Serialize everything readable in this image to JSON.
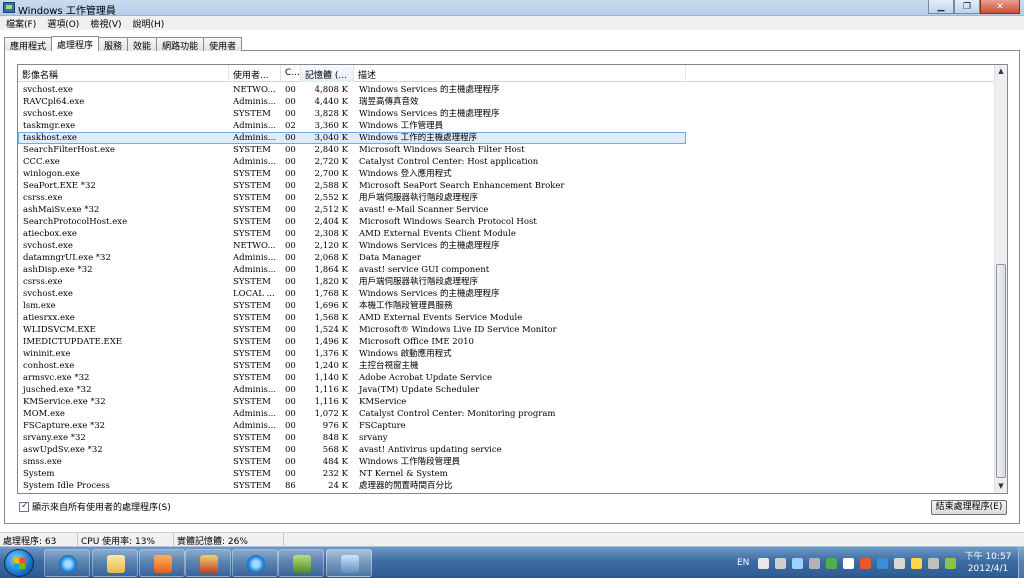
{
  "window": {
    "title": "Windows 工作管理員",
    "min_label": "▁",
    "max_label": "❐",
    "close_label": "✕"
  },
  "menu": [
    "檔案(F)",
    "選項(O)",
    "檢視(V)",
    "說明(H)"
  ],
  "tabs": [
    {
      "label": "應用程式",
      "active": false
    },
    {
      "label": "處理程序",
      "active": true
    },
    {
      "label": "服務",
      "active": false
    },
    {
      "label": "效能",
      "active": false
    },
    {
      "label": "網路功能",
      "active": false
    },
    {
      "label": "使用者",
      "active": false
    }
  ],
  "columns": {
    "name": "影像名稱",
    "user": "使用者...",
    "cpu": "C...",
    "memory": "記憶體 (...",
    "description": "描述"
  },
  "processes": [
    {
      "name": "svchost.exe",
      "user": "NETWO...",
      "cpu": "00",
      "mem": "4,808 K",
      "desc": "Windows Services 的主機處理程序"
    },
    {
      "name": "RAVCpl64.exe",
      "user": "Adminis...",
      "cpu": "00",
      "mem": "4,440 K",
      "desc": "瑞昱高傳真音效"
    },
    {
      "name": "svchost.exe",
      "user": "SYSTEM",
      "cpu": "00",
      "mem": "3,828 K",
      "desc": "Windows Services 的主機處理程序"
    },
    {
      "name": "taskmgr.exe",
      "user": "Adminis...",
      "cpu": "02",
      "mem": "3,360 K",
      "desc": "Windows 工作管理員"
    },
    {
      "name": "taskhost.exe",
      "user": "Adminis...",
      "cpu": "00",
      "mem": "3,040 K",
      "desc": "Windows 工作的主機處理程序"
    },
    {
      "name": "SearchFilterHost.exe",
      "user": "SYSTEM",
      "cpu": "00",
      "mem": "2,840 K",
      "desc": "Microsoft Windows Search Filter Host"
    },
    {
      "name": "CCC.exe",
      "user": "Adminis...",
      "cpu": "00",
      "mem": "2,720 K",
      "desc": "Catalyst Control Center: Host application"
    },
    {
      "name": "winlogon.exe",
      "user": "SYSTEM",
      "cpu": "00",
      "mem": "2,700 K",
      "desc": "Windows 登入應用程式"
    },
    {
      "name": "SeaPort.EXE *32",
      "user": "SYSTEM",
      "cpu": "00",
      "mem": "2,588 K",
      "desc": "Microsoft SeaPort Search Enhancement Broker"
    },
    {
      "name": "csrss.exe",
      "user": "SYSTEM",
      "cpu": "00",
      "mem": "2,552 K",
      "desc": "用戶端伺服器執行階段處理程序"
    },
    {
      "name": "ashMaiSv.exe *32",
      "user": "SYSTEM",
      "cpu": "00",
      "mem": "2,512 K",
      "desc": "avast! e-Mail Scanner Service"
    },
    {
      "name": "SearchProtocolHost.exe",
      "user": "SYSTEM",
      "cpu": "00",
      "mem": "2,404 K",
      "desc": "Microsoft Windows Search Protocol Host"
    },
    {
      "name": "atiecbox.exe",
      "user": "SYSTEM",
      "cpu": "00",
      "mem": "2,308 K",
      "desc": "AMD External Events Client Module"
    },
    {
      "name": "svchost.exe",
      "user": "NETWO...",
      "cpu": "00",
      "mem": "2,120 K",
      "desc": "Windows Services 的主機處理程序"
    },
    {
      "name": "datamngrUI.exe *32",
      "user": "Adminis...",
      "cpu": "00",
      "mem": "2,068 K",
      "desc": "Data Manager"
    },
    {
      "name": "ashDisp.exe *32",
      "user": "Adminis...",
      "cpu": "00",
      "mem": "1,864 K",
      "desc": "avast! service GUI component"
    },
    {
      "name": "csrss.exe",
      "user": "SYSTEM",
      "cpu": "00",
      "mem": "1,820 K",
      "desc": "用戶端伺服器執行階段處理程序"
    },
    {
      "name": "svchost.exe",
      "user": "LOCAL ...",
      "cpu": "00",
      "mem": "1,768 K",
      "desc": "Windows Services 的主機處理程序"
    },
    {
      "name": "lsm.exe",
      "user": "SYSTEM",
      "cpu": "00",
      "mem": "1,696 K",
      "desc": "本機工作階段管理員服務"
    },
    {
      "name": "atiesrxx.exe",
      "user": "SYSTEM",
      "cpu": "00",
      "mem": "1,568 K",
      "desc": "AMD External Events Service Module"
    },
    {
      "name": "WLIDSVCM.EXE",
      "user": "SYSTEM",
      "cpu": "00",
      "mem": "1,524 K",
      "desc": "Microsoft® Windows Live ID Service Monitor"
    },
    {
      "name": "IMEDICTUPDATE.EXE",
      "user": "SYSTEM",
      "cpu": "00",
      "mem": "1,496 K",
      "desc": "Microsoft Office IME 2010"
    },
    {
      "name": "wininit.exe",
      "user": "SYSTEM",
      "cpu": "00",
      "mem": "1,376 K",
      "desc": "Windows 啟動應用程式"
    },
    {
      "name": "conhost.exe",
      "user": "SYSTEM",
      "cpu": "00",
      "mem": "1,240 K",
      "desc": "主控台視窗主機"
    },
    {
      "name": "armsvc.exe *32",
      "user": "SYSTEM",
      "cpu": "00",
      "mem": "1,140 K",
      "desc": "Adobe Acrobat Update Service"
    },
    {
      "name": "jusched.exe *32",
      "user": "Adminis...",
      "cpu": "00",
      "mem": "1,116 K",
      "desc": "Java(TM) Update Scheduler"
    },
    {
      "name": "KMService.exe *32",
      "user": "SYSTEM",
      "cpu": "00",
      "mem": "1,116 K",
      "desc": "KMService"
    },
    {
      "name": "MOM.exe",
      "user": "Adminis...",
      "cpu": "00",
      "mem": "1,072 K",
      "desc": "Catalyst Control Center: Monitoring program"
    },
    {
      "name": "FSCapture.exe *32",
      "user": "Adminis...",
      "cpu": "00",
      "mem": "976 K",
      "desc": "FSCapture"
    },
    {
      "name": "srvany.exe *32",
      "user": "SYSTEM",
      "cpu": "00",
      "mem": "848 K",
      "desc": "srvany"
    },
    {
      "name": "aswUpdSv.exe *32",
      "user": "SYSTEM",
      "cpu": "00",
      "mem": "568 K",
      "desc": "avast! Antivirus updating service"
    },
    {
      "name": "smss.exe",
      "user": "SYSTEM",
      "cpu": "00",
      "mem": "484 K",
      "desc": "Windows 工作階段管理員"
    },
    {
      "name": "System",
      "user": "SYSTEM",
      "cpu": "00",
      "mem": "232 K",
      "desc": "NT Kernel & System"
    },
    {
      "name": "System Idle Process",
      "user": "SYSTEM",
      "cpu": "86",
      "mem": "24 K",
      "desc": "處理器的閒置時間百分比"
    }
  ],
  "selected_index": 4,
  "show_all_label": "顯示來自所有使用者的處理程序(S)",
  "show_all_checked": true,
  "end_process_label": "結束處理程序(E)",
  "status": {
    "processes": "處理程序: 63",
    "cpu": "CPU 使用率: 13%",
    "memory": "實體記憶體: 26%"
  },
  "taskbar": {
    "lang": "EN",
    "time": "下午 10:57",
    "date": "2012/4/1"
  },
  "colors": {
    "selection": "#dfecfb",
    "taskbar": "#3e6da3"
  }
}
